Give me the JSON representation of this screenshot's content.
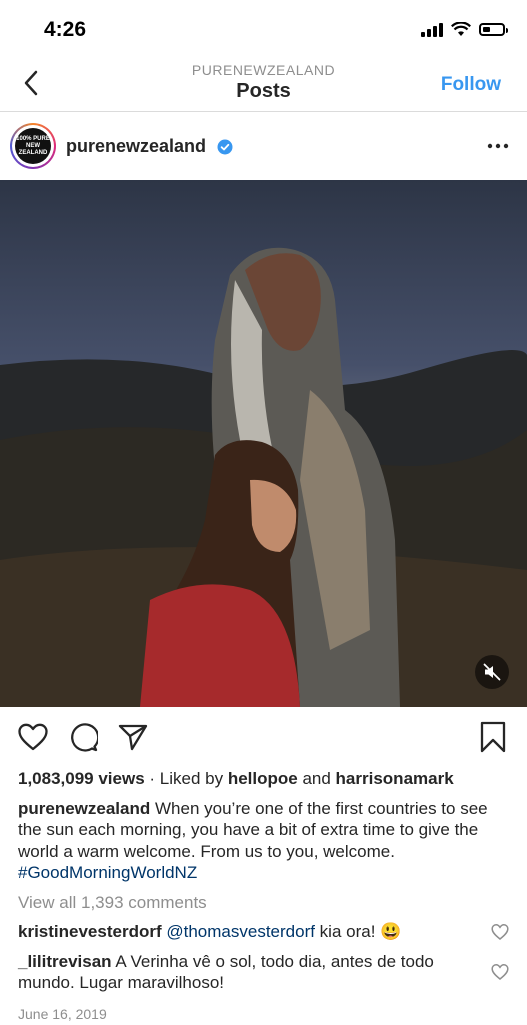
{
  "status_bar": {
    "time": "4:26"
  },
  "nav": {
    "subtitle": "PURENEWZEALAND",
    "title": "Posts",
    "follow_label": "Follow"
  },
  "post": {
    "username": "purenewzealand",
    "avatar_text": [
      "100% PURE",
      "NEW ZEALAND"
    ],
    "views": "1,083,099 views",
    "liked_prefix": " · Liked by ",
    "liked_user1": "hellopoe",
    "liked_and": " and ",
    "liked_user2": "harrisonamark",
    "caption_user": "purenewzealand",
    "caption_text": "When you’re one of the first countries to see the sun each morning, you have a bit of extra time to give the world a warm welcome. From us to you, welcome. ",
    "hashtag": "#GoodMorningWorldNZ",
    "view_all_comments": "View all 1,393 comments",
    "comments": [
      {
        "user": "kristinevesterdorf",
        "mention": "@thomasvesterdorf",
        "text": " kia ora! 😃"
      },
      {
        "user": "_lilitrevisan",
        "mention": "",
        "text": "A Verinha vê o sol, todo dia, antes de todo mundo. Lugar maravilhoso!"
      }
    ],
    "date": "June 16, 2019"
  },
  "colors": {
    "link_blue": "#3897f0",
    "hashtag": "#003569",
    "muted": "#8e8e8e",
    "verified": "#3897f0"
  }
}
